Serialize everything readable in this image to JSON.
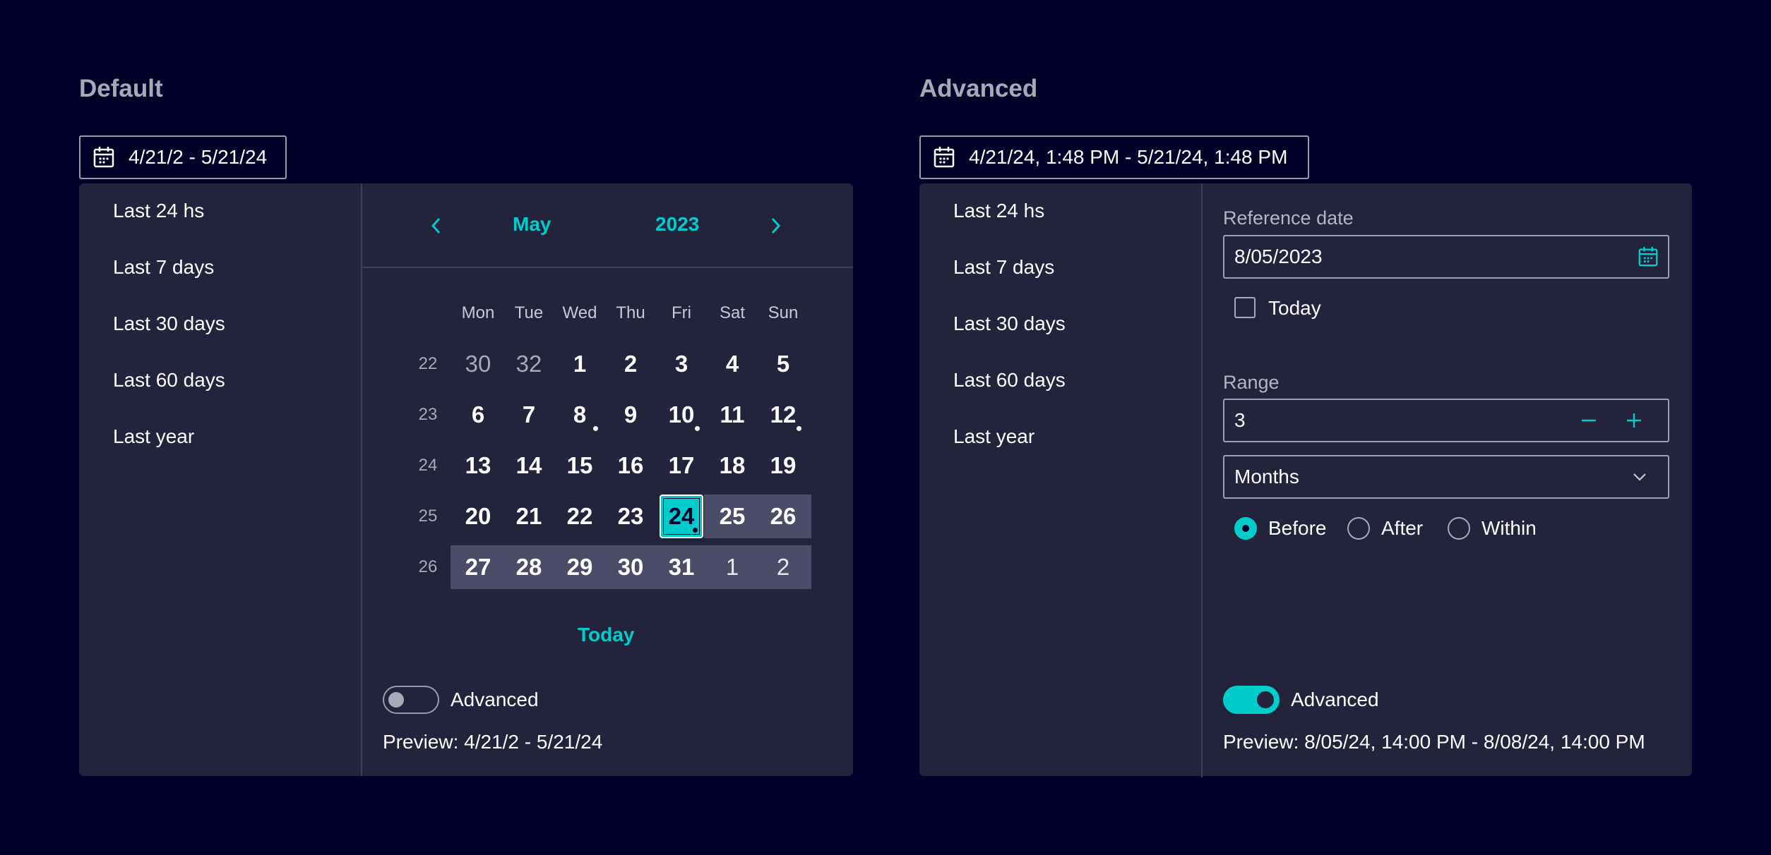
{
  "default": {
    "title": "Default",
    "trigger_value": "4/21/2 - 5/21/24",
    "presets": [
      "Last 24 hs",
      "Last 7 days",
      "Last 30 days",
      "Last 60 days",
      "Last year"
    ],
    "calendar": {
      "month": "May",
      "year": "2023",
      "weekdays": [
        "Mon",
        "Tue",
        "Wed",
        "Thu",
        "Fri",
        "Sat",
        "Sun"
      ],
      "weeks": [
        "22",
        "23",
        "24",
        "25",
        "26"
      ],
      "rows": [
        [
          "30",
          "32",
          "1",
          "2",
          "3",
          "4",
          "5"
        ],
        [
          "6",
          "7",
          "8",
          "9",
          "10",
          "11",
          "12"
        ],
        [
          "13",
          "14",
          "15",
          "16",
          "17",
          "18",
          "19"
        ],
        [
          "20",
          "21",
          "22",
          "23",
          "24",
          "25",
          "26"
        ],
        [
          "27",
          "28",
          "29",
          "30",
          "31",
          "1",
          "2"
        ]
      ],
      "today_label": "Today"
    },
    "advanced_label": "Advanced",
    "advanced_enabled": false,
    "preview": "Preview: 4/21/2 - 5/21/24"
  },
  "advanced": {
    "title": "Advanced",
    "trigger_value": "4/21/24, 1:48 PM - 5/21/24, 1:48 PM",
    "presets": [
      "Last 24 hs",
      "Last 7 days",
      "Last 30 days",
      "Last 60 days",
      "Last year"
    ],
    "reference_date_label": "Reference date",
    "reference_date_value": "8/05/2023",
    "today_checkbox_label": "Today",
    "today_checked": false,
    "range_label": "Range",
    "range_value": "3",
    "unit_value": "Months",
    "radio_options": [
      "Before",
      "After",
      "Within"
    ],
    "radio_selected": "Before",
    "advanced_label": "Advanced",
    "advanced_enabled": true,
    "preview": "Preview: 8/05/24, 14:00 PM - 8/08/24, 14:00 PM"
  },
  "colors": {
    "background": "#000028",
    "panel": "#23233c",
    "accent": "#00cccc",
    "range_highlight": "#4c4c68"
  }
}
